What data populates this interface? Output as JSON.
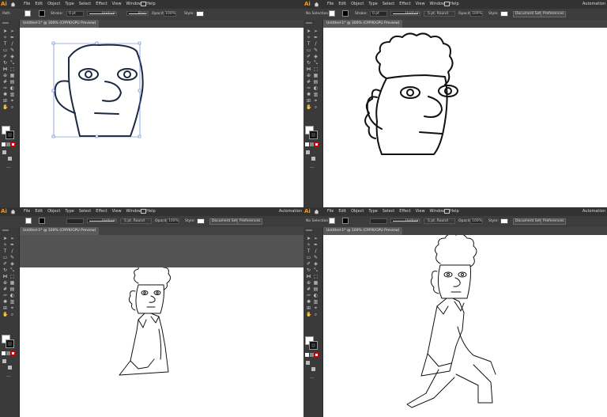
{
  "app": {
    "logo": "Ai",
    "menu": [
      "File",
      "Edit",
      "Object",
      "Type",
      "Select",
      "Effect",
      "View",
      "Window",
      "Help"
    ],
    "workspace_label": "Automation",
    "home_icon": "home-icon",
    "workspace_icon": "grid-icon"
  },
  "panels": [
    {
      "selection_label": "Path",
      "stroke_label": "Stroke:",
      "stroke_value": "0 pt",
      "profile_label": "Uniform",
      "brush_label": "Basic",
      "opacity_label": "Opacity:",
      "opacity_value": "100%",
      "style_label": "Style:",
      "doc_tab": "Untitled-1* @ 300% (CMYK/GPU Preview)"
    },
    {
      "selection_label": "No Selection",
      "stroke_label": "Stroke:",
      "stroke_value": "0 pt",
      "profile_label": "Uniform",
      "brush_label": "5 pt. Round",
      "opacity_label": "Opacity:",
      "opacity_value": "100%",
      "style_label": "Style:",
      "document_setup_label": "Document Setup",
      "preferences_label": "Preferences",
      "doc_tab": "Untitled-1* @ 300% (CMYK/GPU Preview)"
    },
    {
      "doc_tab": "Untitled-1* @ 100% (CMYK/GPU Preview)",
      "profile_label": "Uniform",
      "brush_label": "5 pt. Round",
      "opacity_label": "Opacity:",
      "opacity_value": "100%",
      "style_label": "Style:",
      "document_setup_label": "Document Setup",
      "preferences_label": "Preferences"
    },
    {
      "selection_label": "No Selection",
      "profile_label": "Uniform",
      "brush_label": "5 pt. Round",
      "opacity_label": "Opacity:",
      "opacity_value": "100%",
      "style_label": "Style:",
      "document_setup_label": "Document Setup",
      "preferences_label": "Preferences",
      "doc_tab": "Untitled-1* @ 100% (CMYK/GPU Preview)"
    }
  ],
  "tools": [
    "selection-tool-icon",
    "direct-selection-tool-icon",
    "magic-wand-tool-icon",
    "pen-tool-icon",
    "type-tool-icon",
    "line-tool-icon",
    "rectangle-tool-icon",
    "paintbrush-tool-icon",
    "shaper-tool-icon",
    "eraser-tool-icon",
    "rotate-tool-icon",
    "scale-tool-icon",
    "width-tool-icon",
    "free-transform-tool-icon",
    "shape-builder-tool-icon",
    "perspective-grid-tool-icon",
    "mesh-tool-icon",
    "gradient-tool-icon",
    "eyedropper-tool-icon",
    "blend-tool-icon",
    "symbol-sprayer-tool-icon",
    "column-graph-tool-icon",
    "artboard-tool-icon",
    "slice-tool-icon",
    "hand-tool-icon",
    "zoom-tool-icon"
  ],
  "colors": {
    "ui_dark": "#323232",
    "ui_mid": "#535353",
    "accent": "#ff9a00",
    "selection_blue": "#4a6fcf",
    "stroke": "#111111"
  }
}
